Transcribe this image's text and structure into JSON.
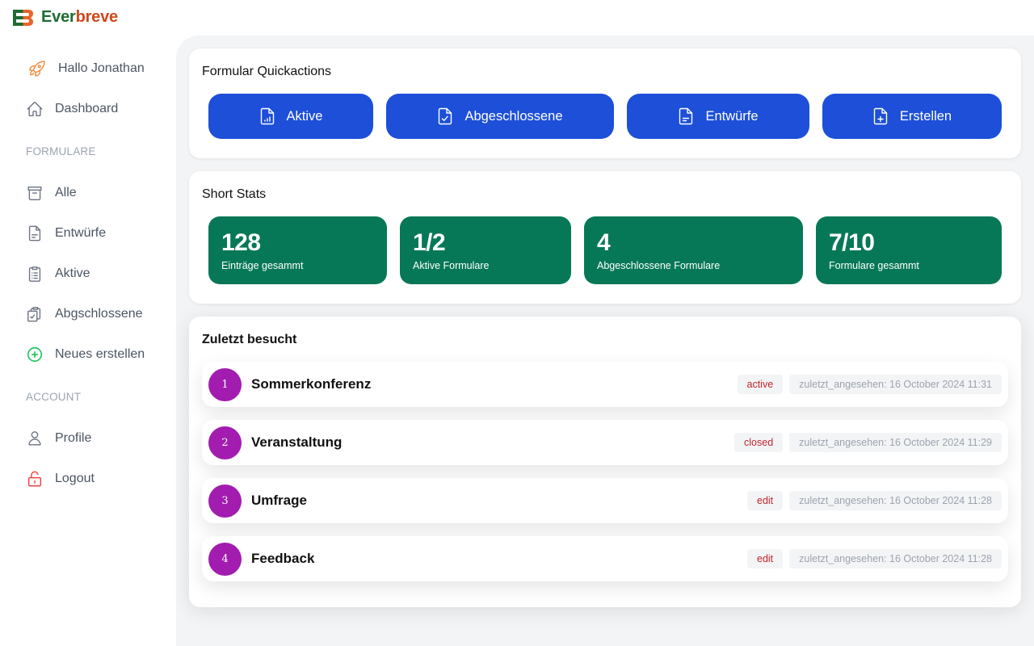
{
  "app": {
    "name_part1": "Ever",
    "name_part2": "breve",
    "colors": {
      "brand_green": "#1f6b32",
      "brand_orange": "#d0481a"
    }
  },
  "sidebar": {
    "greeting": "Hallo Jonathan",
    "dashboard": "Dashboard",
    "section_forms": "FORMULARE",
    "items_forms": [
      {
        "label": "Alle",
        "icon": "archive-icon"
      },
      {
        "label": "Entwürfe",
        "icon": "document-icon"
      },
      {
        "label": "Aktive",
        "icon": "clipboard-list-icon"
      },
      {
        "label": "Abgschlossene",
        "icon": "clipboard-check-icon"
      },
      {
        "label": "Neues erstellen",
        "icon": "plus-circle-icon"
      }
    ],
    "section_account": "ACCOUNT",
    "items_account": [
      {
        "label": "Profile",
        "icon": "user-icon"
      },
      {
        "label": "Logout",
        "icon": "unlock-icon"
      }
    ]
  },
  "quickactions": {
    "title": "Formular Quickactions",
    "buttons": [
      {
        "label": "Aktive",
        "icon": "document-chart-icon"
      },
      {
        "label": "Abgeschlossene",
        "icon": "document-check-icon"
      },
      {
        "label": "Entwürfe",
        "icon": "document-text-icon"
      },
      {
        "label": "Erstellen",
        "icon": "document-plus-icon"
      }
    ],
    "color": "#1d4fd8"
  },
  "stats": {
    "title": "Short Stats",
    "items": [
      {
        "value": "128",
        "label": "Einträge gesammt"
      },
      {
        "value": "1/2",
        "label": "Aktive Formulare"
      },
      {
        "value": "4",
        "label": "Abgeschlossene Formulare"
      },
      {
        "value": "7/10",
        "label": "Formulare gesammt"
      }
    ],
    "color": "#077857"
  },
  "recent": {
    "title": "Zuletzt besucht",
    "items": [
      {
        "num": "1",
        "name": "Sommerkonferenz",
        "status": "active",
        "time": "zuletzt_angesehen: 16 October 2024 11:31"
      },
      {
        "num": "2",
        "name": "Veranstaltung",
        "status": "closed",
        "time": "zuletzt_angesehen: 16 October 2024 11:29"
      },
      {
        "num": "3",
        "name": "Umfrage",
        "status": "edit",
        "time": "zuletzt_angesehen: 16 October 2024 11:28"
      },
      {
        "num": "4",
        "name": "Feedback",
        "status": "edit",
        "time": "zuletzt_angesehen: 16 October 2024 11:28"
      }
    ],
    "status_color": "#c0262d",
    "avatar_color": "#a21caf"
  }
}
